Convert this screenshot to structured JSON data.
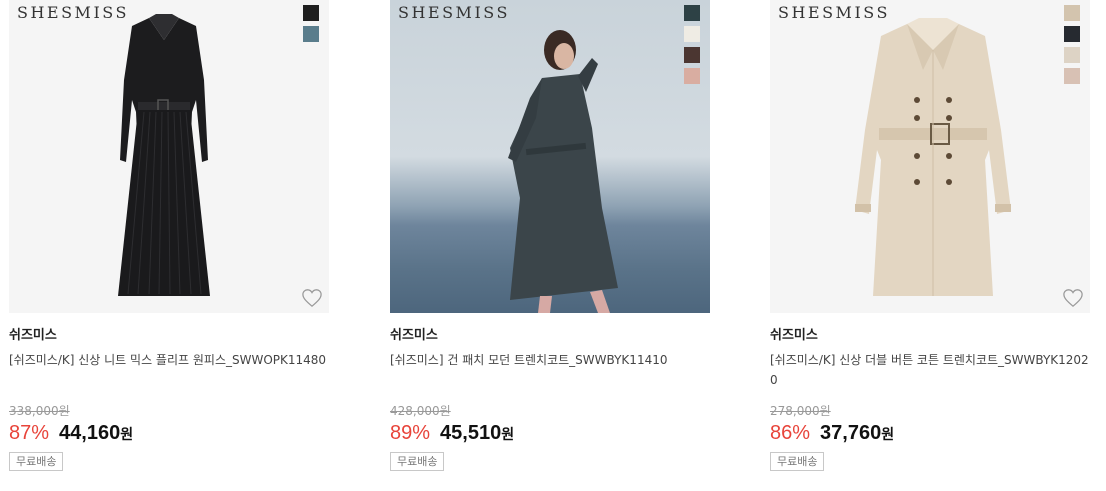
{
  "products": [
    {
      "logo_text": "SHESMISS",
      "swatches": [
        "#1f1f1f",
        "#5a7d8c"
      ],
      "brand": "쉬즈미스",
      "title": "[쉬즈미스/K] 신상 니트 믹스 플리프 원피스_SWWOPK11480",
      "original_price": "338,000원",
      "discount": "87%",
      "price": "44,160",
      "currency": "원",
      "shipping_badge": "무료배송"
    },
    {
      "logo_text": "SHESMISS",
      "swatches": [
        "#2d4145",
        "#efece4",
        "#4b3631",
        "#d9ada1"
      ],
      "brand": "쉬즈미스",
      "title": "[쉬즈미스] 건 패치 모던 트렌치코트_SWWBYK11410",
      "original_price": "428,000원",
      "discount": "89%",
      "price": "45,510",
      "currency": "원",
      "shipping_badge": "무료배송"
    },
    {
      "logo_text": "SHESMISS",
      "swatches": [
        "#d3c4ae",
        "#262a30",
        "#ddd3c5",
        "#d8c1b4"
      ],
      "brand": "쉬즈미스",
      "title": "[쉬즈미스/K] 신상 더블 버튼 코튼 트렌치코트_SWWBYK12020",
      "original_price": "278,000원",
      "discount": "86%",
      "price": "37,760",
      "currency": "원",
      "shipping_badge": "무료배송"
    }
  ]
}
